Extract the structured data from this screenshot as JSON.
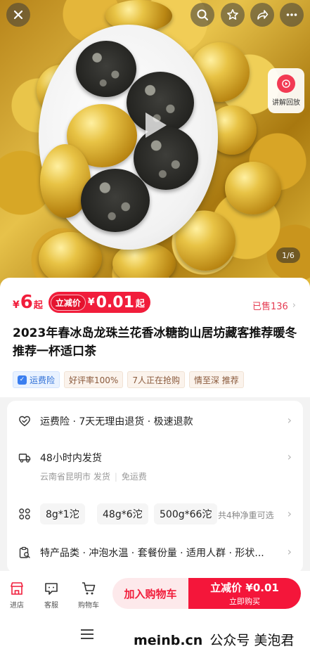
{
  "hero": {
    "page_indicator": "1/6",
    "replay_label": "讲解回放",
    "icons": [
      "close-icon",
      "search-icon",
      "star-icon",
      "share-icon",
      "more-icon"
    ]
  },
  "product": {
    "price_currency": "¥",
    "price_value": "6",
    "price_unit": "起",
    "deal_label": "立减价",
    "deal_currency": "¥",
    "deal_value": "0.01",
    "deal_unit": "起",
    "sold": "已售136",
    "title": "2023年春冰岛龙珠兰花香冰糖韵山居坊藏客推荐暖冬推荐一杯适口茶",
    "tags": [
      "运费险",
      "好评率100%",
      "7人正在抢购",
      "情至深 推荐"
    ]
  },
  "info": {
    "service": "运费险 · 7天无理由退货 · 极速退款",
    "shipping": "48小时内发货",
    "shipping_from": "云南省昆明市 发货",
    "shipping_fee": "免运费",
    "specs": [
      "8g*1沱",
      "48g*6沱",
      "500g*66沱"
    ],
    "specs_note": "共4种净重可选",
    "params": "特产品类 · 冲泡水温 · 套餐份量 · 适用人群 · 形状..."
  },
  "bottom_bar": {
    "store": "进店",
    "service": "客服",
    "cart": "购物车",
    "add_to_cart": "加入购物车",
    "buy_line1": "立减价 ¥0.01",
    "buy_line2": "立即购买"
  },
  "watermark": {
    "site": "meinb.cn",
    "account": "公众号 美泡君"
  },
  "colors": {
    "accent": "#f11d3b",
    "deal_bg": "#f4163a"
  }
}
